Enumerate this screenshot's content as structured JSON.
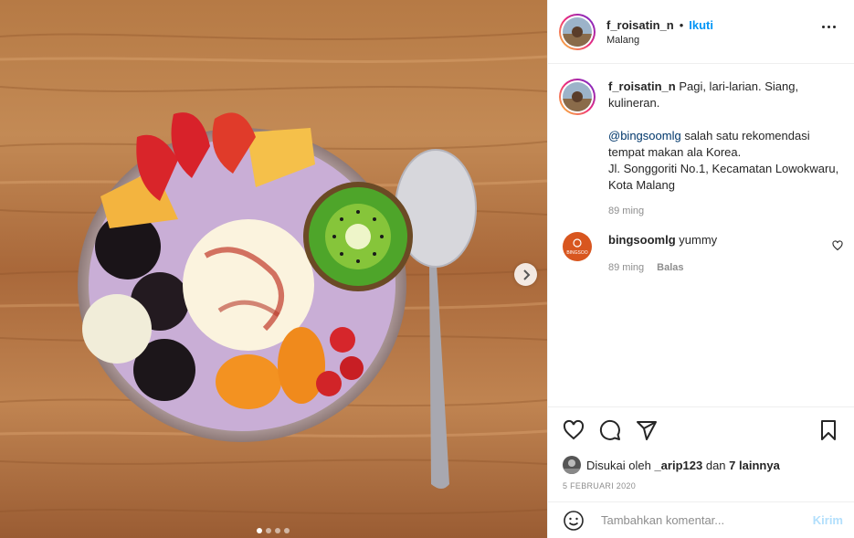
{
  "post": {
    "image_description_icon": "dessert-photo",
    "carousel": {
      "slide_count": 4,
      "active_index": 0
    }
  },
  "header": {
    "username": "f_roisatin_n",
    "bullet": "•",
    "follow_label": "Ikuti",
    "location": "Malang",
    "more_icon": "more-options-icon"
  },
  "caption": {
    "username": "f_roisatin_n",
    "line1": "Pagi, lari-larian. Siang, kulineran.",
    "mention": "@bingsoomlg",
    "line2": "salah satu rekomendasi tempat makan ala Korea.",
    "line3": "Jl. Songgoriti No.1, Kecamatan Lowokwaru, Kota Malang",
    "time": "89 ming"
  },
  "comments": [
    {
      "username": "bingsoomlg",
      "text": "yummy",
      "time": "89 ming",
      "reply_label": "Balas",
      "avatar_text": "BINGSOO"
    }
  ],
  "likes": {
    "prefix": "Disukai oleh",
    "user": "_arip123",
    "conj": "dan",
    "others": "7 lainnya"
  },
  "date": "5 FEBRUARI 2020",
  "add_comment": {
    "placeholder": "Tambahkan komentar...",
    "post_label": "Kirim"
  },
  "colors": {
    "follow": "#0095f6",
    "post_disabled": "#b2dffc",
    "muted": "#8e8e8e"
  }
}
